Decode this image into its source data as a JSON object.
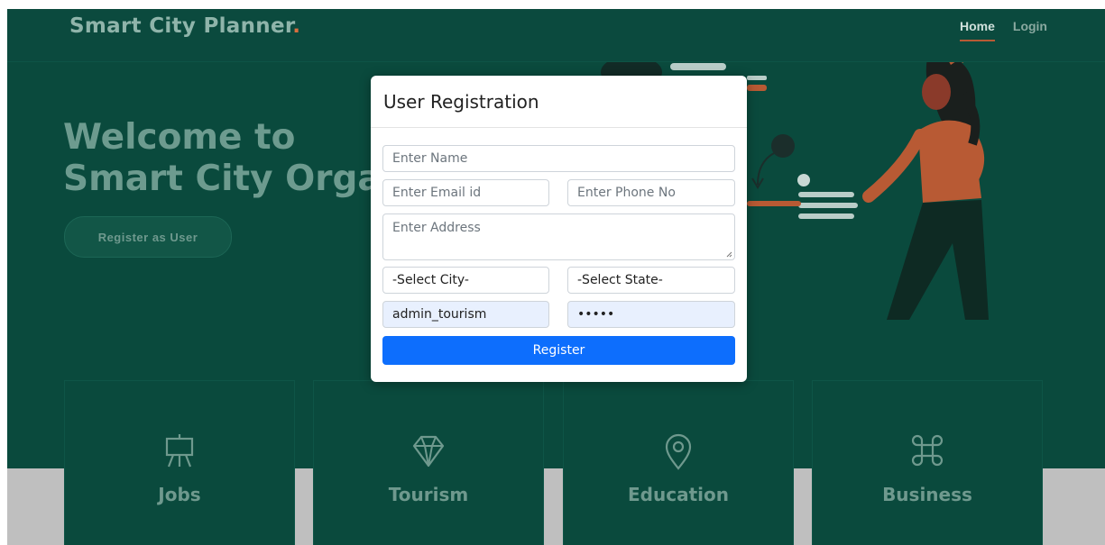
{
  "brand": {
    "name": "Smart City Planner",
    "dot": "."
  },
  "nav": {
    "home": "Home",
    "login": "Login"
  },
  "hero": {
    "line1": "Welcome to",
    "line2": "Smart City Orga",
    "register_button": "Register as User"
  },
  "cards": [
    {
      "label": "Jobs",
      "icon": "easel-icon"
    },
    {
      "label": "Tourism",
      "icon": "gem-icon"
    },
    {
      "label": "Education",
      "icon": "map-pin-icon"
    },
    {
      "label": "Business",
      "icon": "command-icon"
    }
  ],
  "modal": {
    "title": "User Registration",
    "name_placeholder": "Enter  Name",
    "email_placeholder": "Enter Email id",
    "phone_placeholder": "Enter Phone No",
    "address_placeholder": "Enter Address",
    "city_select": "-Select City-",
    "state_select": "-Select State-",
    "username_value": "admin_tourism",
    "password_value": "•••••",
    "submit_label": "Register"
  },
  "colors": {
    "hero_bg": "#0a4a3d",
    "accent": "#d96f3f",
    "primary_button": "#0d6efd",
    "autofill_bg": "#e8f0fe"
  }
}
